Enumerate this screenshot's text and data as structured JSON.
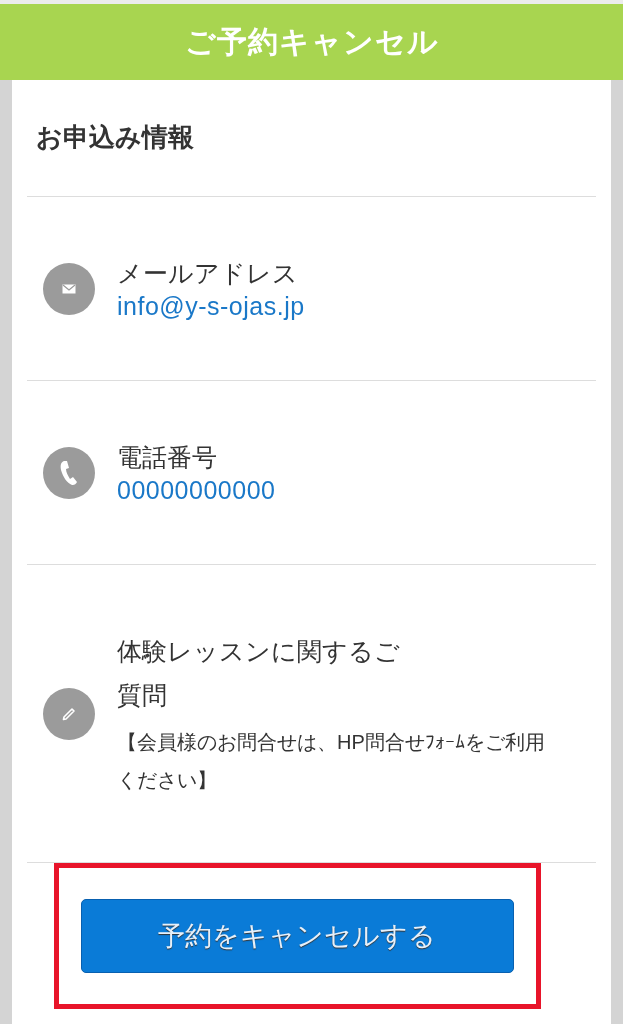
{
  "header": {
    "title": "ご予約キャンセル"
  },
  "section": {
    "title": "お申込み情報"
  },
  "fields": [
    {
      "kind": "email",
      "label": "メールアドレス",
      "value": "info@y-s-ojas.jp"
    },
    {
      "kind": "phone",
      "label": "電話番号",
      "value": "00000000000"
    },
    {
      "kind": "question",
      "label": "体験レッスンに関するご質問",
      "note": "【会員様のお問合せは、HP問合せﾌｫｰﾑをご利用ください】"
    }
  ],
  "cancel_button": {
    "label": "予約をキャンセルする",
    "highlighted": true
  }
}
